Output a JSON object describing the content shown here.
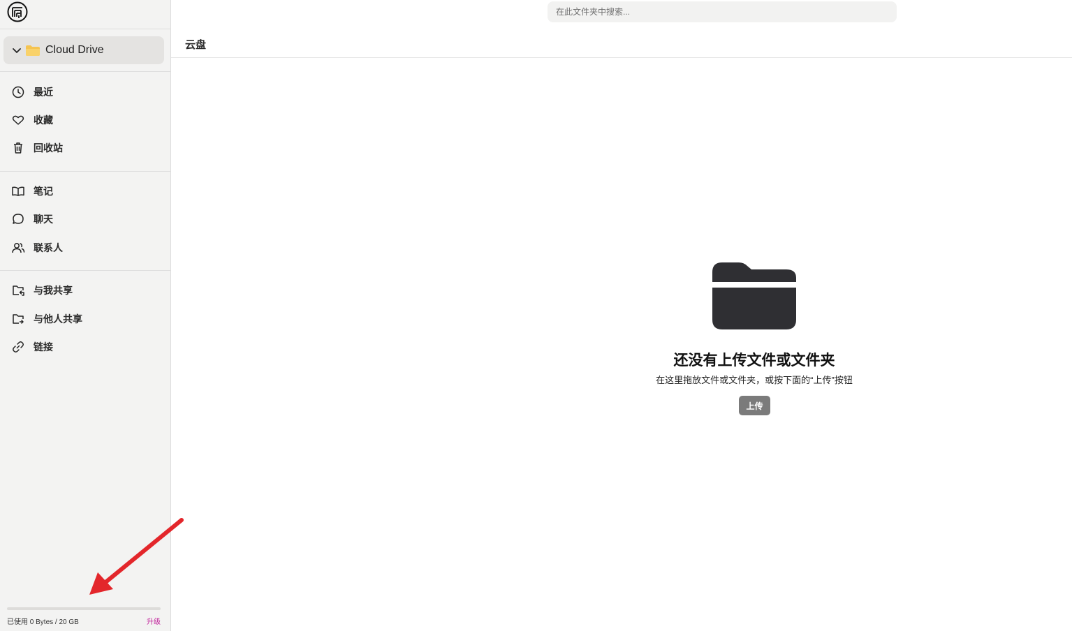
{
  "sidebar": {
    "drive": {
      "label": "Cloud Drive"
    },
    "group1": [
      {
        "label": "最近",
        "icon": "clock-icon"
      },
      {
        "label": "收藏",
        "icon": "heart-icon"
      },
      {
        "label": "回收站",
        "icon": "trash-icon"
      }
    ],
    "group2": [
      {
        "label": "笔记",
        "icon": "book-icon"
      },
      {
        "label": "聊天",
        "icon": "chat-bubble-icon"
      },
      {
        "label": "联系人",
        "icon": "contacts-icon"
      }
    ],
    "group3": [
      {
        "label": "与我共享",
        "icon": "shared-with-me-icon"
      },
      {
        "label": "与他人共享",
        "icon": "shared-by-me-icon"
      },
      {
        "label": "链接",
        "icon": "link-icon"
      }
    ],
    "storage": {
      "text": "已使用 0 Bytes / 20 GB",
      "used_fraction": 0,
      "upgrade_label": "升级"
    }
  },
  "search": {
    "placeholder": "在此文件夹中搜索..."
  },
  "breadcrumb": {
    "current": "云盘"
  },
  "empty_state": {
    "title": "还没有上传文件或文件夹",
    "subtitle": "在这里拖放文件或文件夹，或按下面的“上传”按钮",
    "upload_label": "上传"
  },
  "colors": {
    "sidebar_bg": "#f3f3f2",
    "accent_upgrade": "#c0209a",
    "folder_icon": "#2f2f33",
    "annotation_arrow": "#e3262b"
  }
}
